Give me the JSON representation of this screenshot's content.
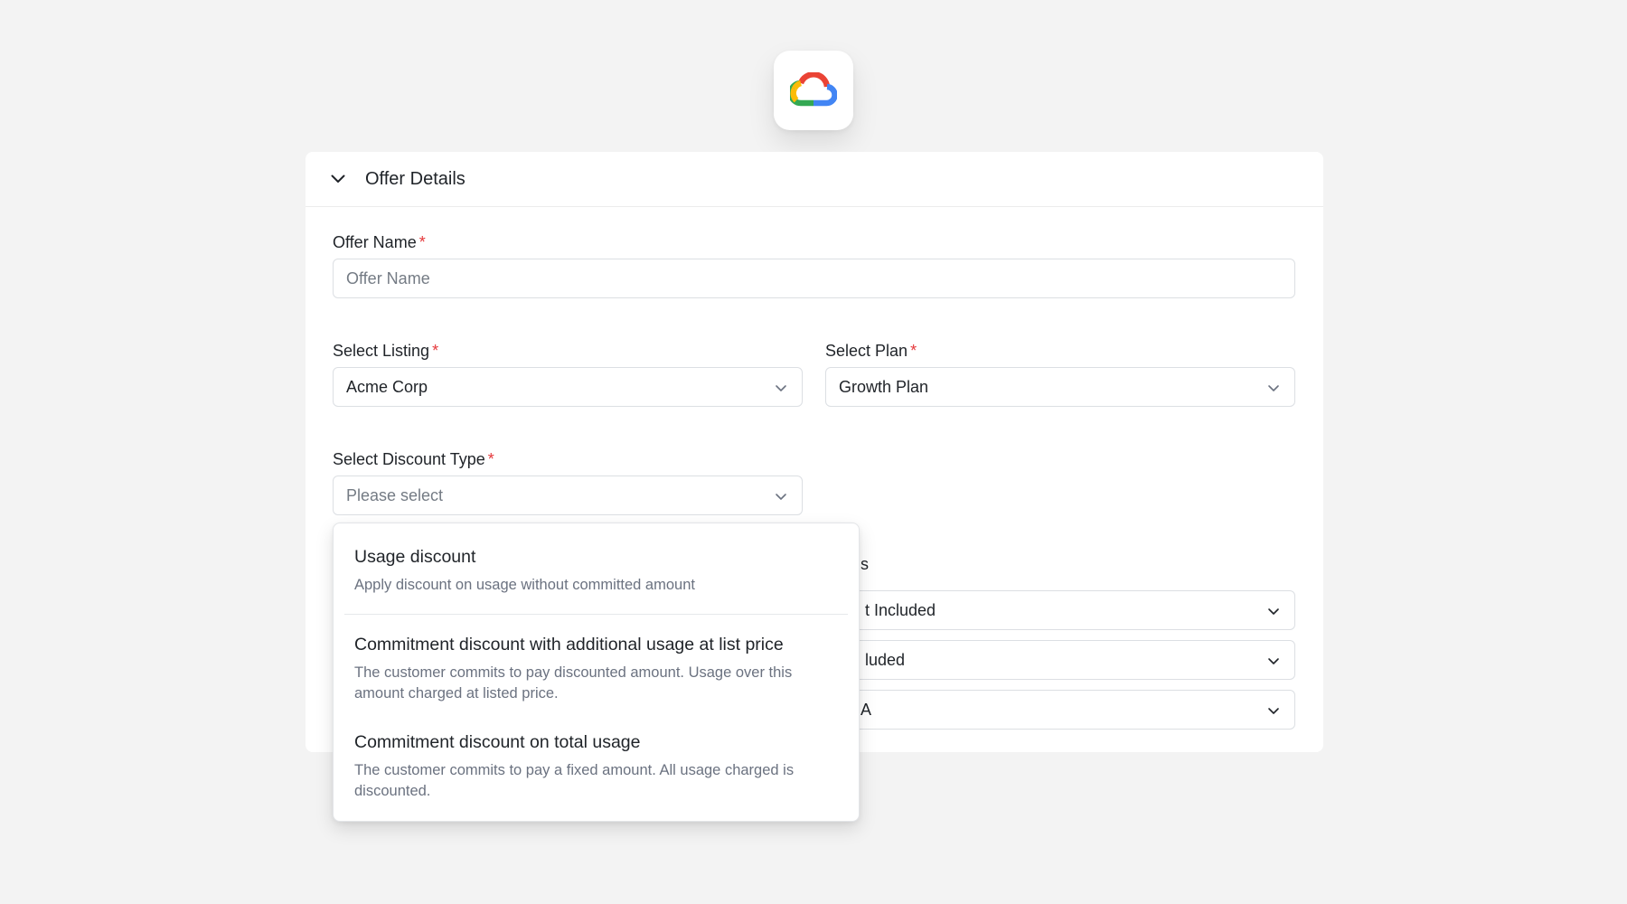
{
  "header": {
    "title": "Offer Details"
  },
  "form": {
    "offer_name": {
      "label": "Offer Name",
      "required_mark": "*",
      "placeholder": "Offer Name"
    },
    "listing": {
      "label": "Select Listing",
      "required_mark": "*",
      "value": "Acme Corp"
    },
    "plan": {
      "label": "Select Plan",
      "required_mark": "*",
      "value": "Growth Plan"
    },
    "discount_type": {
      "label": "Select Discount Type",
      "required_mark": "*",
      "placeholder": "Please select"
    }
  },
  "background_section": {
    "label_fragment": "ils",
    "selects": [
      "t Included",
      "luded",
      "A"
    ]
  },
  "dropdown": {
    "options": [
      {
        "title": "Usage discount",
        "description": "Apply discount on usage without committed amount"
      },
      {
        "title": "Commitment discount with additional usage at list price",
        "description": "The customer commits to pay discounted amount. Usage over this amount charged at listed price."
      },
      {
        "title": "Commitment discount on total usage",
        "description": "The customer commits to pay a fixed amount. All usage charged is discounted."
      }
    ]
  },
  "icons": {
    "logo": "google-cloud-logo",
    "collapse": "chevron-down-icon",
    "select_caret": "chevron-down-icon"
  },
  "colors": {
    "required": "#e5383b",
    "background": "#f3f3f3"
  }
}
